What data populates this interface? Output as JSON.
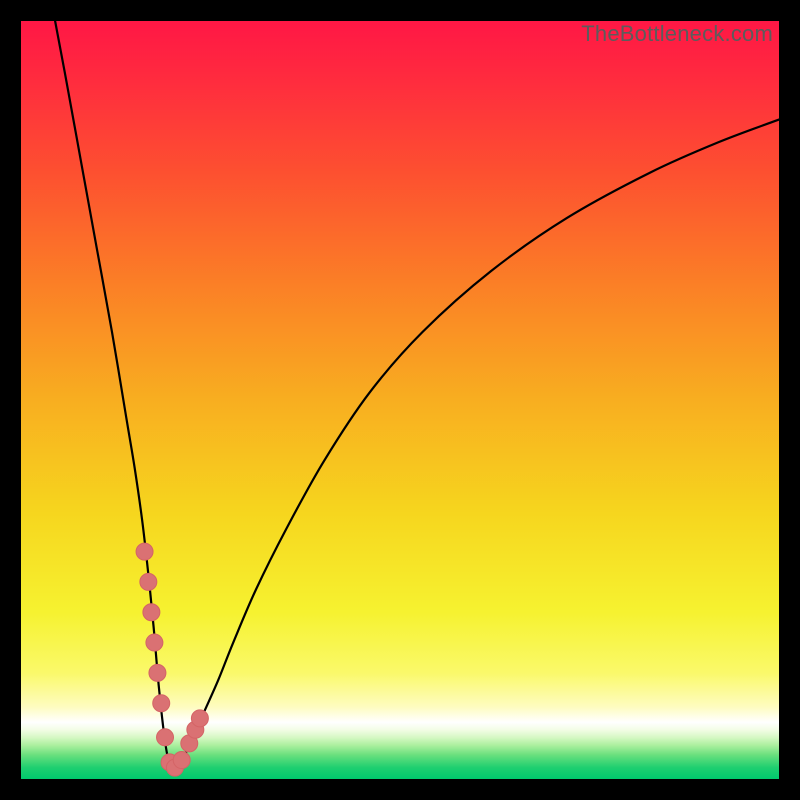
{
  "watermark": "TheBottleneck.com",
  "colors": {
    "frame": "#000000",
    "curve_stroke": "#000000",
    "marker_fill": "#da7173",
    "marker_stroke": "#d46466",
    "watermark": "#5c5c5c"
  },
  "gradient_stops": [
    {
      "offset": 0.0,
      "color": "#ff1745"
    },
    {
      "offset": 0.08,
      "color": "#ff2c3e"
    },
    {
      "offset": 0.2,
      "color": "#fd5030"
    },
    {
      "offset": 0.35,
      "color": "#fb8026"
    },
    {
      "offset": 0.5,
      "color": "#f8ae20"
    },
    {
      "offset": 0.65,
      "color": "#f6d61e"
    },
    {
      "offset": 0.78,
      "color": "#f6f230"
    },
    {
      "offset": 0.86,
      "color": "#faf96a"
    },
    {
      "offset": 0.905,
      "color": "#fefcc0"
    },
    {
      "offset": 0.925,
      "color": "#ffffff"
    },
    {
      "offset": 0.935,
      "color": "#f3fde6"
    },
    {
      "offset": 0.945,
      "color": "#d6f8c5"
    },
    {
      "offset": 0.955,
      "color": "#aef0a0"
    },
    {
      "offset": 0.968,
      "color": "#6be07e"
    },
    {
      "offset": 0.985,
      "color": "#1ecf70"
    },
    {
      "offset": 1.0,
      "color": "#00c96d"
    }
  ],
  "chart_data": {
    "type": "line",
    "title": "",
    "xlabel": "",
    "ylabel": "",
    "xlim": [
      0,
      100
    ],
    "ylim": [
      0,
      100
    ],
    "series": [
      {
        "name": "curve",
        "x": [
          4.5,
          6,
          8,
          10,
          12,
          14,
          15,
          16,
          16.8,
          17.5,
          18.2,
          19,
          19.6,
          20.3,
          21.2,
          22.5,
          24,
          26,
          28,
          31,
          35,
          40,
          46,
          53,
          62,
          72,
          83,
          92,
          100
        ],
        "y": [
          100,
          92,
          81,
          70,
          59,
          47,
          41,
          34,
          27,
          20,
          12,
          5,
          2,
          1.5,
          2.5,
          5,
          8.5,
          13,
          18,
          25,
          33,
          42,
          51,
          59,
          67,
          74,
          80,
          84,
          87
        ]
      }
    ],
    "markers": {
      "name": "highlight-points",
      "x": [
        16.3,
        16.8,
        17.2,
        17.6,
        18.0,
        18.5,
        19.0,
        19.6,
        20.3,
        21.2,
        22.2,
        23.0,
        23.6
      ],
      "y": [
        30,
        26,
        22,
        18,
        14,
        10,
        5.5,
        2.2,
        1.5,
        2.5,
        4.7,
        6.5,
        8.0
      ]
    }
  }
}
